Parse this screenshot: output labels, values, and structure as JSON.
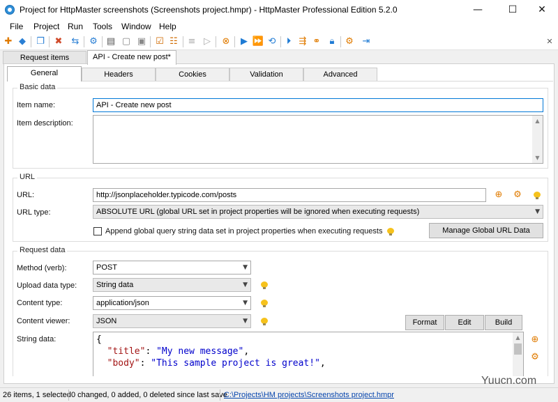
{
  "window": {
    "title": "Project for HttpMaster screenshots (Screenshots project.hmpr) - HttpMaster Professional Edition 5.2.0",
    "minimize": "—",
    "maximize": "☐",
    "close": "✕"
  },
  "menu": [
    "File",
    "Project",
    "Run",
    "Tools",
    "Window",
    "Help"
  ],
  "doc_tabs": [
    "Request items",
    "API - Create new post*"
  ],
  "inner_tabs": [
    "General",
    "Headers",
    "Cookies",
    "Validation",
    "Advanced"
  ],
  "basic": {
    "group_title": "Basic data",
    "item_name_label": "Item name:",
    "item_name_value": "API - Create new post",
    "item_desc_label": "Item description:",
    "item_desc_value": ""
  },
  "url": {
    "group_title": "URL",
    "url_label": "URL:",
    "url_value": "http://jsonplaceholder.typicode.com/posts",
    "url_type_label": "URL type:",
    "url_type_value": "ABSOLUTE URL (global URL set in project properties will be ignored when executing requests)",
    "append_label": "Append global query string data set in project properties when executing requests",
    "manage_button": "Manage Global URL Data"
  },
  "request": {
    "group_title": "Request data",
    "method_label": "Method (verb):",
    "method_value": "POST",
    "upload_label": "Upload data type:",
    "upload_value": "String data",
    "content_type_label": "Content type:",
    "content_type_value": "application/json",
    "viewer_label": "Content viewer:",
    "viewer_value": "JSON",
    "format_button": "Format",
    "edit_button": "Edit",
    "build_button": "Build",
    "string_data_label": "String data:",
    "string_lines": [
      {
        "brace": "{"
      },
      {
        "key": "\"title\"",
        "colon": ": ",
        "value": "\"My new message\"",
        "comma": ","
      },
      {
        "key": "\"body\"",
        "colon": ": ",
        "value": "\"This sample project is great!\"",
        "comma": ","
      }
    ]
  },
  "status": {
    "items": "26 items, 1 selected",
    "changes": "0 changed, 0 added, 0 deleted since last save",
    "path": "C:\\Projects\\HM projects\\Screenshots project.hmpr"
  },
  "watermark": "Yuucn.com",
  "colors": {
    "accent": "#0078d7",
    "json_key": "#a31515",
    "json_string": "#0000cc"
  }
}
